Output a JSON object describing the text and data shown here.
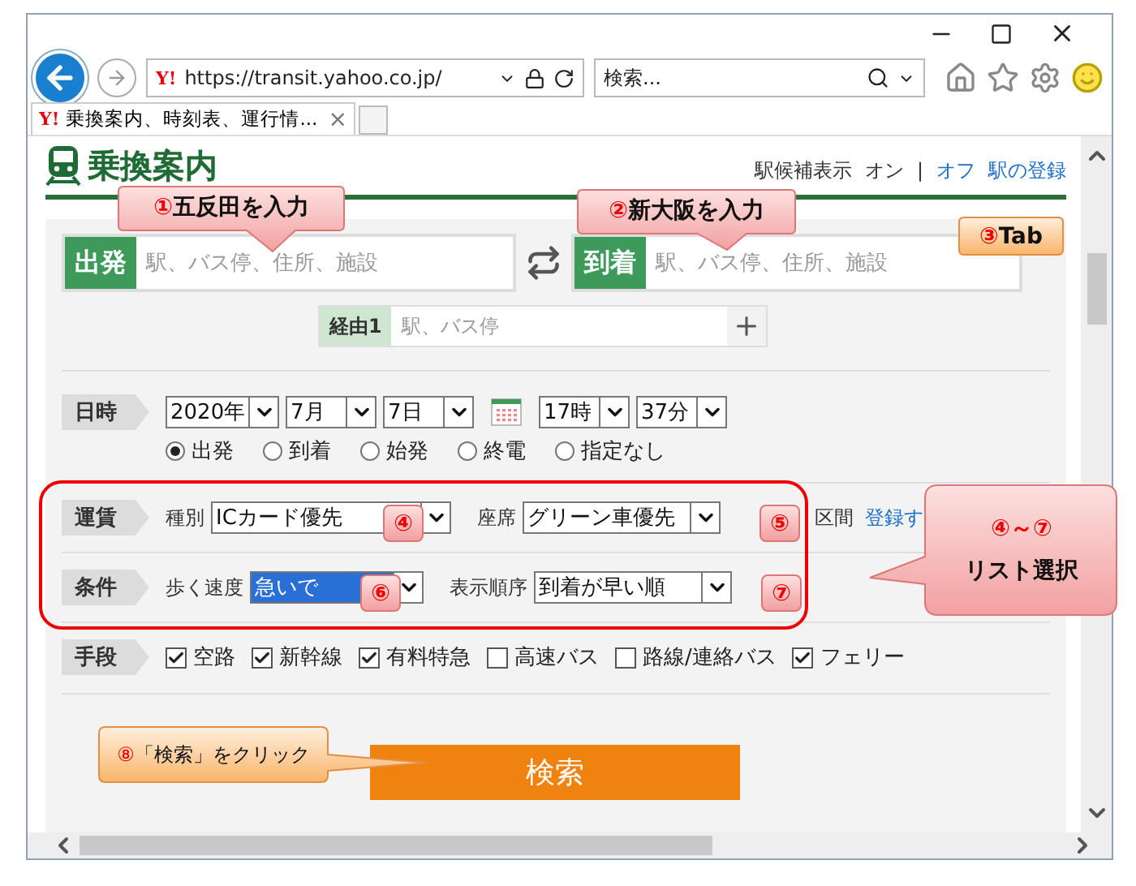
{
  "browser": {
    "address_bar": {
      "logo": "Y!",
      "url": "https://transit.yahoo.co.jp/"
    },
    "search_box": {
      "placeholder": "検索..."
    },
    "tabs": [
      {
        "logo": "Y!",
        "title": "乗換案内、時刻表、運行情...",
        "close": "×",
        "selected": true
      }
    ]
  },
  "page": {
    "logo": "乗換案内",
    "station_hint": {
      "label": "駅候補表示",
      "separator": "|",
      "options": [
        {
          "label": "オン",
          "selected": true
        },
        {
          "label": "オフ",
          "selected": false
        }
      ]
    },
    "register_link": "駅の登録",
    "from": {
      "label": "出発",
      "placeholder": "駅、バス停、住所、施設"
    },
    "to": {
      "label": "到着",
      "placeholder": "駅、バス停、住所、施設"
    },
    "via": {
      "label": "経由1",
      "placeholder": "駅、バス停"
    },
    "datetime": {
      "label": "日時",
      "date_selects": [
        "2020年",
        "7月",
        "7日"
      ],
      "time_selects": [
        "17時",
        "37分"
      ],
      "radios": [
        {
          "label": "出発",
          "selected": true
        },
        {
          "label": "到着",
          "selected": false
        },
        {
          "label": "始発",
          "selected": false
        },
        {
          "label": "終電",
          "selected": false
        },
        {
          "label": "指定なし",
          "selected": false
        }
      ]
    },
    "fare": {
      "label": "運賃",
      "fields": [
        {
          "label": "種別",
          "value": "ICカード優先",
          "highlighted": false
        },
        {
          "label": "座席",
          "value": "グリーン車優先",
          "highlighted": false
        }
      ],
      "section_label": "区間",
      "link": "登録す"
    },
    "conditions": {
      "label": "条件",
      "fields": [
        {
          "label": "歩く速度",
          "value": "急いで",
          "highlighted": true
        },
        {
          "label": "表示順序",
          "value": "到着が早い順",
          "highlighted": false
        }
      ]
    },
    "means": {
      "label": "手段",
      "options": [
        {
          "label": "空路",
          "checked": true
        },
        {
          "label": "新幹線",
          "checked": true
        },
        {
          "label": "有料特急",
          "checked": true
        },
        {
          "label": "高速バス",
          "checked": false
        },
        {
          "label": "路線/連絡バス",
          "checked": false
        },
        {
          "label": "フェリー",
          "checked": true
        }
      ]
    },
    "search_button": "検索"
  },
  "annotations": [
    {
      "kind": "callout",
      "mark": "①",
      "text": "五反田を入力"
    },
    {
      "kind": "callout",
      "mark": "②",
      "text": "新大阪を入力"
    },
    {
      "kind": "note",
      "mark": "③",
      "text": "Tab"
    },
    {
      "kind": "badge",
      "mark": "④"
    },
    {
      "kind": "badge",
      "mark": "⑤"
    },
    {
      "kind": "badge",
      "mark": "⑥"
    },
    {
      "kind": "badge",
      "mark": "⑦"
    },
    {
      "kind": "big",
      "mark": "④～⑦",
      "text": "リスト選択"
    },
    {
      "kind": "note",
      "mark": "⑧",
      "text": "「検索」をクリック"
    }
  ]
}
